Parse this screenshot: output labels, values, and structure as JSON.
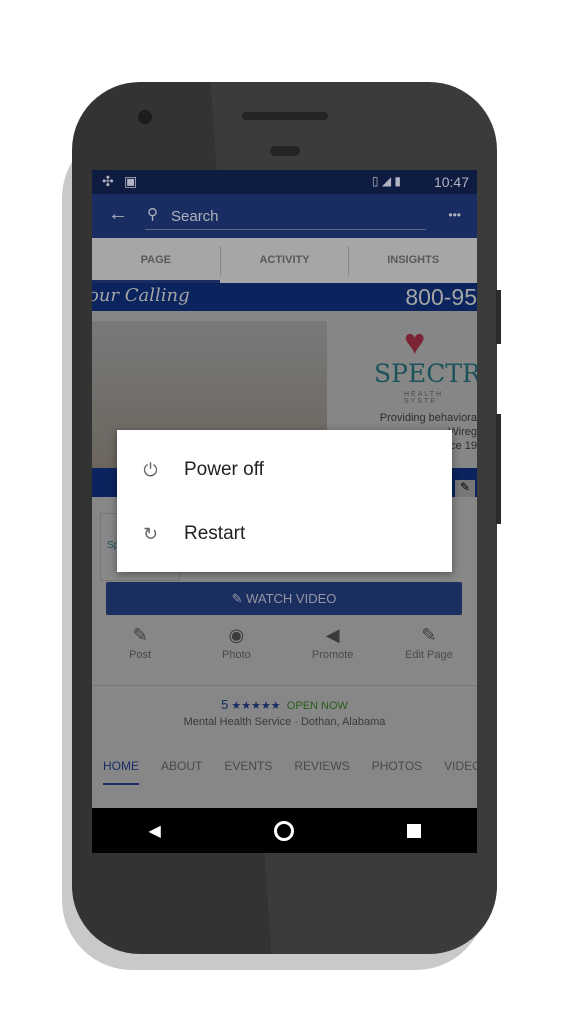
{
  "status_bar": {
    "time": "10:47"
  },
  "app_bar": {
    "search_placeholder": "Search",
    "more": "•••"
  },
  "tabs": [
    {
      "label": "PAGE",
      "active": true
    },
    {
      "label": "ACTIVITY"
    },
    {
      "label": "INSIGHTS"
    }
  ],
  "cover": {
    "tagline": "our Calling",
    "phone": "800-95",
    "logo": "SPECTRAC",
    "logo_sub": "HEALTH SYSTE",
    "desc_lines": [
      "Providing behaviora",
      "Wireg",
      "ce 19"
    ]
  },
  "card": {
    "logo_fragment": "Sp"
  },
  "watch_video": "WATCH VIDEO",
  "actions": [
    {
      "label": "Post",
      "icon": "compose-icon"
    },
    {
      "label": "Photo",
      "icon": "camera-icon"
    },
    {
      "label": "Promote",
      "icon": "megaphone-icon"
    },
    {
      "label": "Edit Page",
      "icon": "pencil-icon"
    }
  ],
  "rating": {
    "value": "5",
    "stars": "★★★★★",
    "open": "OPEN NOW",
    "category": "Mental Health Service · Dothan, Alabama"
  },
  "page_tabs": [
    "HOME",
    "ABOUT",
    "EVENTS",
    "REVIEWS",
    "PHOTOS",
    "VIDEO"
  ],
  "dialog": {
    "power_off": "Power off",
    "restart": "Restart"
  },
  "colors": {
    "brand": "#3b5998",
    "open": "#4caf50"
  }
}
